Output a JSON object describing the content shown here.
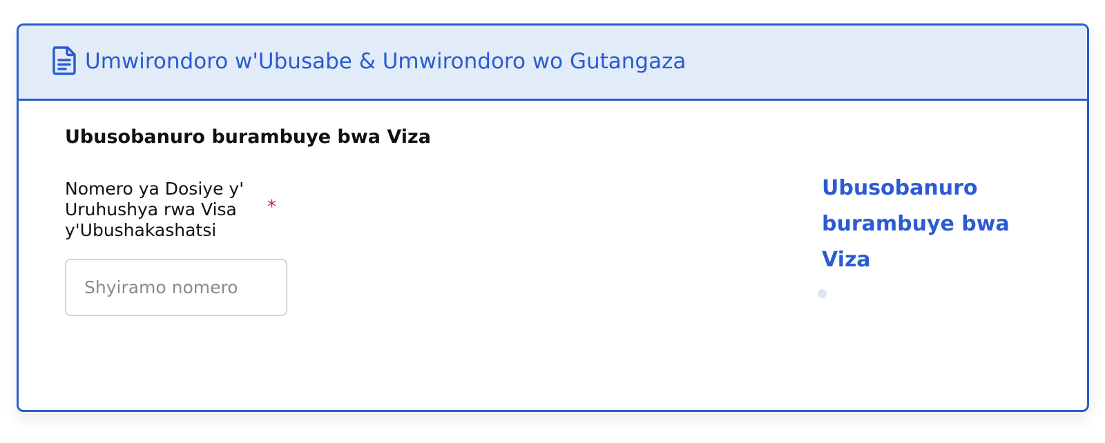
{
  "header": {
    "icon": "document-icon",
    "title": "Umwirondoro w'Ubusabe & Umwirondoro wo Gutangaza"
  },
  "section": {
    "title": "Ubusobanuro burambuye bwa Viza"
  },
  "field": {
    "label": "Nomero ya Dosiye y' Uruhushya rwa Visa y'Ubushakashatsi",
    "required_mark": "*",
    "placeholder": "Shyiramo nomero",
    "value": ""
  },
  "side_nav": {
    "title": "Ubusobanuro burambuye bwa Viza"
  },
  "colors": {
    "accent": "#2a5bd0",
    "header_bg": "#e1ecf8",
    "required": "#d6202c"
  }
}
